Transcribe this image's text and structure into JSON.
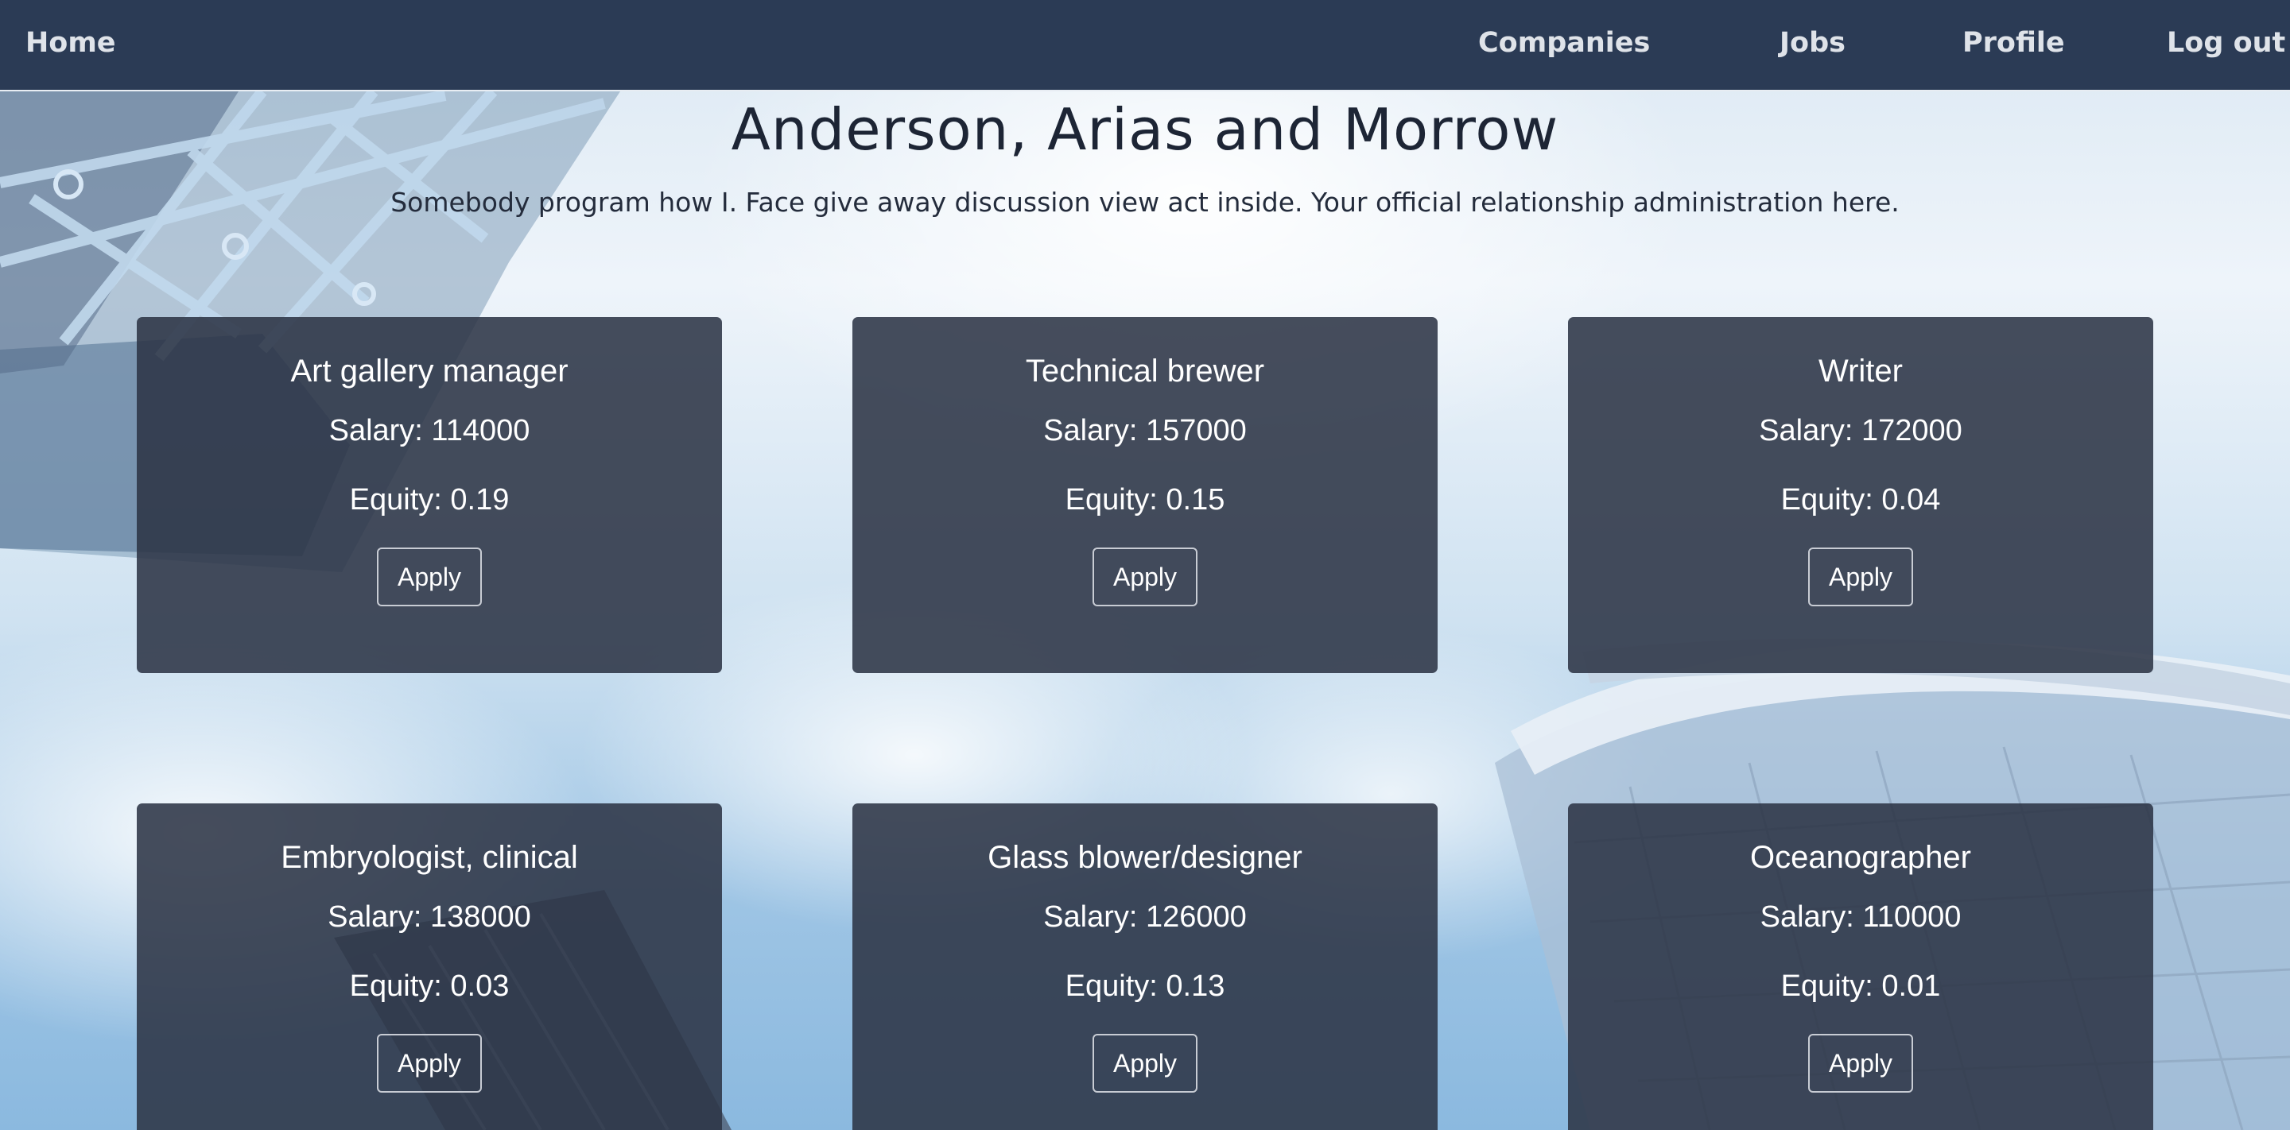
{
  "navbar": {
    "home_label": "Home",
    "links": [
      {
        "label": "Companies"
      },
      {
        "label": "Jobs"
      },
      {
        "label": "Profile"
      },
      {
        "label": "Log out"
      }
    ]
  },
  "company": {
    "name": "Anderson, Arias and Morrow",
    "description": "Somebody program how I. Face give away discussion view act inside. Your official relationship administration here."
  },
  "jobs": [
    {
      "title": "Art gallery manager",
      "salary": "Salary: 114000",
      "equity": "Equity: 0.19",
      "apply_label": "Apply"
    },
    {
      "title": "Technical brewer",
      "salary": "Salary: 157000",
      "equity": "Equity: 0.15",
      "apply_label": "Apply"
    },
    {
      "title": "Writer",
      "salary": "Salary: 172000",
      "equity": "Equity: 0.04",
      "apply_label": "Apply"
    },
    {
      "title": "Embryologist, clinical",
      "salary": "Salary: 138000",
      "equity": "Equity: 0.03",
      "apply_label": "Apply"
    },
    {
      "title": "Glass blower/designer",
      "salary": "Salary: 126000",
      "equity": "Equity: 0.13",
      "apply_label": "Apply"
    },
    {
      "title": "Oceanographer",
      "salary": "Salary: 110000",
      "equity": "Equity: 0.01",
      "apply_label": "Apply"
    }
  ],
  "colors": {
    "navbar_bg": "#2b3b55",
    "nav_text": "#dfe3e9",
    "card_bg": "#2c3446",
    "heading_text": "#1d2535"
  }
}
